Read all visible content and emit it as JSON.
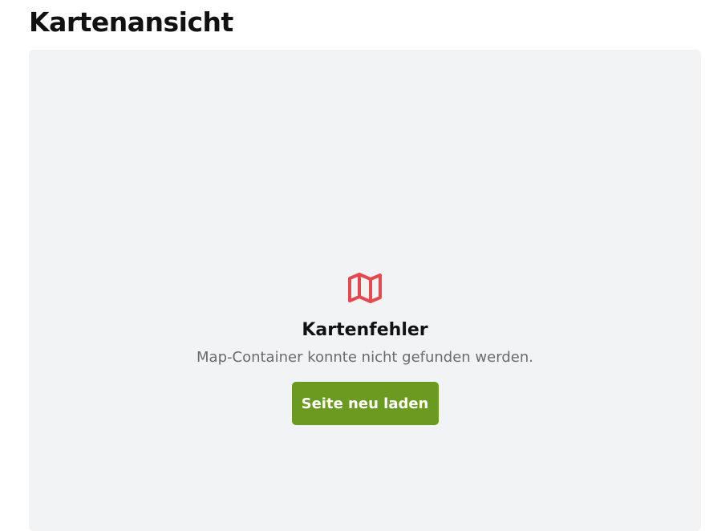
{
  "page": {
    "title": "Kartenansicht"
  },
  "map_error": {
    "icon": "map-icon",
    "icon_color": "#e5484d",
    "title": "Kartenfehler",
    "message": "Map-Container konnte nicht gefunden werden.",
    "button_label": "Seite neu laden",
    "button_color": "#6a9a1f"
  },
  "colors": {
    "panel_background": "#f2f3f5",
    "text_primary": "#111111",
    "text_muted": "#6b6b6b"
  }
}
